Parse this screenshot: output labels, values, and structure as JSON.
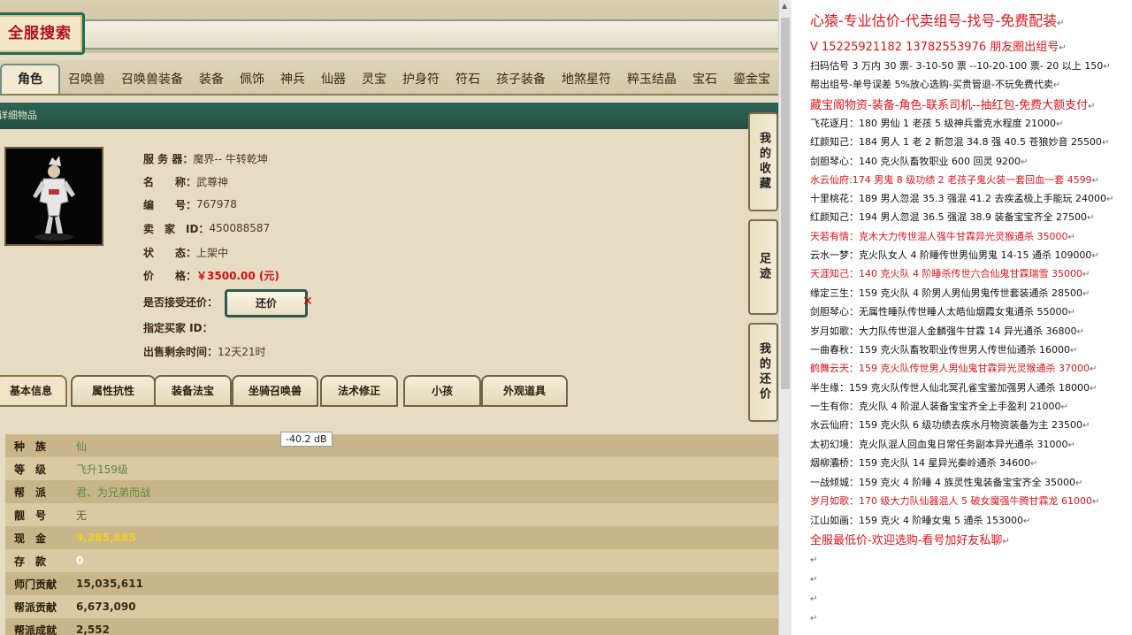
{
  "search_title": "全服搜索",
  "categories": [
    "角色",
    "召唤兽",
    "召唤兽装备",
    "装备",
    "佩饰",
    "神兵",
    "仙器",
    "灵宝",
    "护身符",
    "符石",
    "孩子装备",
    "地煞星符",
    "粹玉结晶",
    "宝石",
    "鎏金宝"
  ],
  "section_title": "详细物品",
  "item": {
    "server_label": "服 务 器：",
    "server": "魔界-- 牛转乾坤",
    "name_label": "名　　称：",
    "name": "武尊神",
    "id_label": "编　　号：",
    "id": "767978",
    "seller_label": "卖　家　ID：",
    "seller": "450088587",
    "status_label": "状　　态：",
    "status": "上架中",
    "price_label": "价　　格：",
    "price": "￥3500.00 (元)",
    "bargain_label": "是否接受还价：",
    "bargain_button": "还价",
    "buyer_label": "指定买家 ID：",
    "buyer": "",
    "remaining_label": "出售剩余时间：",
    "remaining": "12天21时"
  },
  "side_tabs": [
    "我的收藏",
    "足迹",
    "我的还价"
  ],
  "subtabs": [
    "基本信息",
    "属性抗性",
    "装备法宝",
    "坐骑召唤兽",
    "法术修正",
    "小孩",
    "外观道具"
  ],
  "tooltip": "-40.2 dB",
  "stats": [
    {
      "k": "种　族",
      "v": "仙",
      "color": "#5a8a3a"
    },
    {
      "k": "等　级",
      "v": "飞升159级",
      "color": "#5a8a3a"
    },
    {
      "k": "帮　派",
      "v": "君、为兄弟而战",
      "color": "#5a8a3a"
    },
    {
      "k": "靓　号",
      "v": "无",
      "color": "#6a5a20"
    },
    {
      "k": "现　金",
      "v": "9,285,885",
      "color": "#f0d020"
    },
    {
      "k": "存　款",
      "v": "0",
      "color": "#ffffff"
    },
    {
      "k": "师门贡献",
      "v": "15,035,611",
      "color": "#3a2a10"
    },
    {
      "k": "帮派贡献",
      "v": "6,673,090",
      "color": "#3a2a10"
    },
    {
      "k": "帮派成就",
      "v": "2,552",
      "color": "#3a2a10"
    }
  ],
  "doc_lines": [
    {
      "t": "心猿-专业估价-代卖组号-找号-免费配装",
      "red": true,
      "size": "big"
    },
    {
      "t": "V 15225921182   13782553976 朋友圈出组号",
      "red": true,
      "size": "med"
    },
    {
      "t": "扫码估号 3 万内 30 票- 3-10-50 票  --10-20-100 票- 20 以上 150",
      "red": false
    },
    {
      "t": "帮出组号-单号误差 5%放心选购-买贵管退-不玩免费代卖",
      "red": false
    },
    {
      "t": "藏宝阁物资-装备-角色-联系司机--抽红包-免费大额支付",
      "red": true,
      "size": "med"
    },
    {
      "t": "飞花逐月：180 男仙 1 老孩 5 级神兵雷克水程度 21000",
      "red": false
    },
    {
      "t": "红颜知己：184 男人 1 老 2 新忽混 34.8 强 40.5 苍狼妙音 25500",
      "red": false
    },
    {
      "t": "剑胆琴心：140 克火队畜牧职业 600 回灵 9200",
      "red": false
    },
    {
      "t": "水云仙府:174 男鬼 8 级功绩 2 老孩子鬼火装一套回血一套 4599",
      "red": true
    },
    {
      "t": "十里桃花：189 男人忽混 35.3 强混 41.2 去疾孟极上手能玩 24000",
      "red": false
    },
    {
      "t": "红颜知己：194 男人忽混 36.5 强混 38.9 装备宝宝齐全 27500",
      "red": false
    },
    {
      "t": "天若有情：克木大力传世混人强牛甘霖异光灵猴通杀 35000",
      "red": true
    },
    {
      "t": "云水一梦：克火队女人 4 阶睡传世男仙男鬼 14-15 通杀 109000",
      "red": false
    },
    {
      "t": "天涯知己：140 克火队 4 阶睡杀传世六合仙鬼甘霖瑞雪 35000",
      "red": true
    },
    {
      "t": "缘定三生：159 克火队 4 阶男人男仙男鬼传世套装通杀 28500",
      "red": false
    },
    {
      "t": "剑胆琴心：无属性睡队传世睡人太皓仙烟霞女鬼通杀 55000",
      "red": false
    },
    {
      "t": "岁月如歌：大力队传世混人金麟强牛甘霖 14 异光通杀 36800",
      "red": false
    },
    {
      "t": "一曲春秋：159 克火队畜牧职业传世男人传世仙通杀 16000",
      "red": false
    },
    {
      "t": "鹤舞云天：159 克火队传世男人男仙鬼甘霖异光灵猴通杀 37000",
      "red": true
    },
    {
      "t": "半生缘：159 克火队传世人仙北冥孔雀宝鉴加强男人通杀 18000",
      "red": false
    },
    {
      "t": "一生有你：克火队 4 阶混人装备宝宝齐全上手盈利 21000",
      "red": false
    },
    {
      "t": "水云仙府：159 克火队 6 级功绩去疾水月物资装备为主 23500",
      "red": false
    },
    {
      "t": "太初幻境：克火队混人回血鬼日常任务副本异光通杀 31000",
      "red": false
    },
    {
      "t": "烟柳灞桥：159 克火队 14 星异光秦岭通杀 34600",
      "red": false
    },
    {
      "t": "一战倾城：159 克火 4 阶睡 4 族灵性鬼装备宝宝齐全 35000",
      "red": false
    },
    {
      "t": "岁月如歌：170 级大力队仙器混人 5 破女魔强牛腾甘霖龙 61000",
      "red": true
    },
    {
      "t": "江山如画：159 克火 4 阶睡女鬼 5 通杀 153000",
      "red": false
    },
    {
      "t": "全服最低价-欢迎选购-看号加好友私聊",
      "red": true,
      "size": "med"
    }
  ]
}
